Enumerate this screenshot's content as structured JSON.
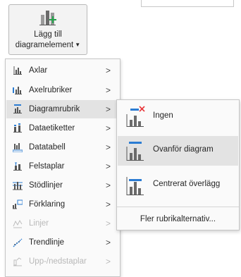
{
  "ribbon": {
    "label_line1": "Lägg till",
    "label_line2": "diagramelement",
    "caret_icon": "chevron-down-icon"
  },
  "menu": {
    "items": [
      {
        "label": "Axlar",
        "icon": "axes-icon",
        "state": "normal",
        "has_submenu": true
      },
      {
        "label": "Axelrubriker",
        "icon": "axis-titles-icon",
        "state": "normal",
        "has_submenu": true
      },
      {
        "label": "Diagramrubrik",
        "icon": "chart-title-icon",
        "state": "active",
        "has_submenu": true
      },
      {
        "label": "Dataetiketter",
        "icon": "data-labels-icon",
        "state": "normal",
        "has_submenu": true
      },
      {
        "label": "Datatabell",
        "icon": "data-table-icon",
        "state": "normal",
        "has_submenu": true
      },
      {
        "label": "Felstaplar",
        "icon": "error-bars-icon",
        "state": "normal",
        "has_submenu": true
      },
      {
        "label": "Stödlinjer",
        "icon": "gridlines-icon",
        "state": "normal",
        "has_submenu": true
      },
      {
        "label": "Förklaring",
        "icon": "legend-icon",
        "state": "normal",
        "has_submenu": true
      },
      {
        "label": "Linjer",
        "icon": "lines-icon",
        "state": "disabled",
        "has_submenu": true
      },
      {
        "label": "Trendlinje",
        "icon": "trendline-icon",
        "state": "normal",
        "has_submenu": true
      },
      {
        "label": "Upp-/nedstaplar",
        "icon": "up-down-bars-icon",
        "state": "disabled",
        "has_submenu": true
      }
    ],
    "arrow_glyph": ">"
  },
  "submenu": {
    "items": [
      {
        "label": "Ingen",
        "icon": "no-title-icon",
        "state": "normal"
      },
      {
        "label": "Ovanför diagram",
        "icon": "title-above-chart-icon",
        "state": "active"
      },
      {
        "label": "Centrerat överlägg",
        "icon": "centered-overlay-title-icon",
        "state": "normal"
      }
    ],
    "more_label": "Fler rubrikalternativ..."
  },
  "colors": {
    "accent_blue": "#2b7cd3",
    "close_red": "#e8373a",
    "green_plus": "#22a34a",
    "chart_gray": "#6b6b6b"
  }
}
